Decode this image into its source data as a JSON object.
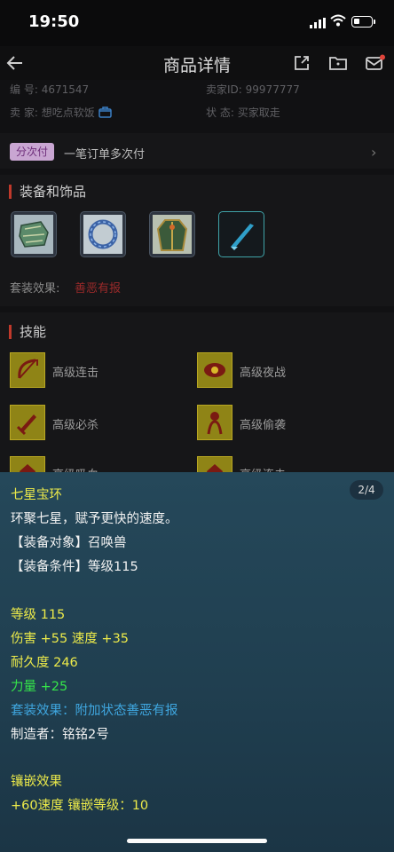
{
  "status_bar": {
    "time": "19:50"
  },
  "nav": {
    "title": "商品详情"
  },
  "info": {
    "id_label": "编 号:",
    "id_value": "4671547",
    "seller_id_label": "卖家ID:",
    "seller_id_value": "99977777",
    "seller_label": "卖 家:",
    "seller_value": "想吃点软饭",
    "state_label": "状 态:",
    "state_value": "买家取走"
  },
  "payment": {
    "badge": "分次付",
    "text": "一笔订单多次付"
  },
  "equipment": {
    "title": "装备和饰品",
    "items": [
      "armguard",
      "ring",
      "robe",
      "blade"
    ],
    "set_effect_label": "套装效果:",
    "set_effect_value": "善恶有报"
  },
  "skills": {
    "title": "技能",
    "items": [
      {
        "label": "高级连击",
        "icon": "bow"
      },
      {
        "label": "高级夜战",
        "icon": "eye"
      },
      {
        "label": "高级必杀",
        "icon": "sword"
      },
      {
        "label": "高级偷袭",
        "icon": "figure"
      },
      {
        "label": "高级吸血",
        "icon": "beast"
      },
      {
        "label": "高级连击",
        "icon": "beast"
      }
    ]
  },
  "tooltip": {
    "page": "2/4",
    "name": "七星宝环",
    "desc": "环聚七星，赋予更快的速度。",
    "target": "【装备对象】召唤兽",
    "condition": "【装备条件】等级115",
    "level": "等级 115",
    "damage_speed": "伤害 +55 速度 +35",
    "durability": "耐久度 246",
    "strength": "力量 +25",
    "set_effect": "套装效果：附加状态善恶有报",
    "maker": "制造者：铭铭2号",
    "inlay_title": "镶嵌效果",
    "inlay_value": "+60速度 镶嵌等级：10"
  },
  "colors": {
    "tooltip_bg": "#25485a",
    "yellow": "#ecea4a",
    "green": "#35e54a",
    "blue": "#3fa7e0",
    "accent_red": "#c0392b"
  }
}
